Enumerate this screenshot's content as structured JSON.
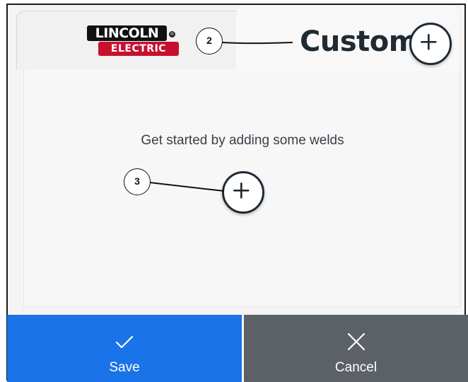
{
  "tabs": {
    "brand": {
      "logo_top": "LINCOLN",
      "logo_bottom": "ELECTRIC",
      "logo_mark": "®"
    },
    "custom": {
      "label": "Custom",
      "add_icon": "plus-circle-icon"
    }
  },
  "main": {
    "empty_message": "Get started by adding some welds",
    "add_icon": "plus-circle-icon"
  },
  "callouts": [
    "2",
    "3"
  ],
  "footer": {
    "save_label": "Save",
    "save_icon": "check-icon",
    "cancel_label": "Cancel",
    "cancel_icon": "close-icon"
  },
  "colors": {
    "save_bg": "#1a73e8",
    "cancel_bg": "#5c6168",
    "brand_red": "#c8102e",
    "text_dark": "#1f2a33"
  }
}
